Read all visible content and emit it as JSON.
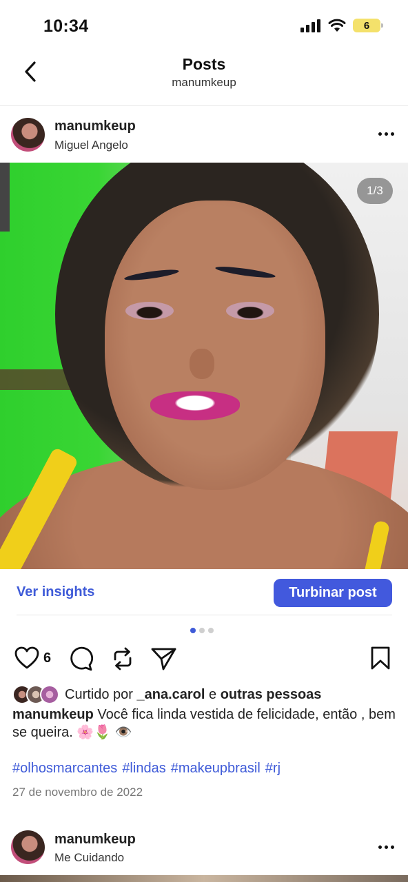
{
  "status_bar": {
    "time": "10:34",
    "battery_level": "6"
  },
  "header": {
    "title": "Posts",
    "subtitle": "manumkeup"
  },
  "post": {
    "username": "manumkeup",
    "subtitle": "Miguel Angelo",
    "image_counter": "1/3",
    "image_total": 3,
    "image_index": 1,
    "insights_label": "Ver insights",
    "boost_label": "Turbinar post",
    "like_count": "6",
    "liked_by_prefix": "Curtido por",
    "liked_by_user": "_ana.carol",
    "liked_by_join": "e",
    "liked_by_others": "outras pessoas",
    "caption_user": "manumkeup",
    "caption_text": "Você fica linda vestida de felicidade, então , bem se queira. 🌸🌷 👁️",
    "hashtags": [
      "#olhosmarcantes",
      "#lindas",
      "#makeupbrasil",
      "#rj"
    ],
    "date": "27 de novembro de 2022"
  },
  "next_post": {
    "username": "manumkeup",
    "subtitle": "Me Cuidando"
  },
  "colors": {
    "accent": "#4259dd",
    "link": "#3f5bd8",
    "battery": "#f4e16b"
  }
}
